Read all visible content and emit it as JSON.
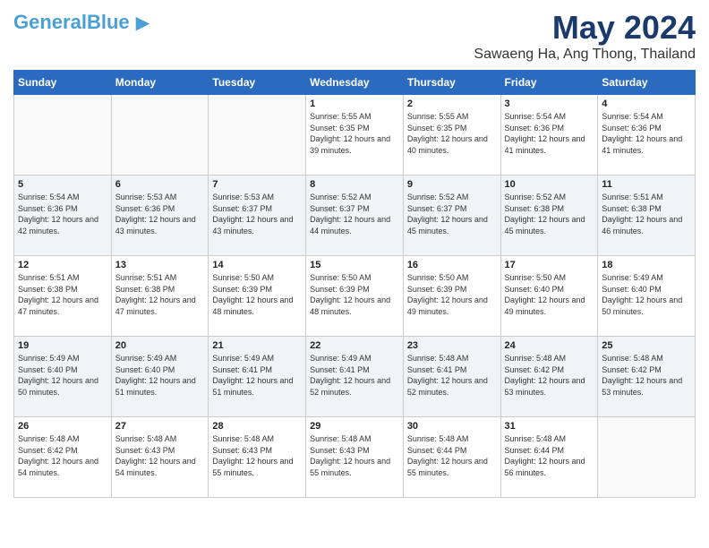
{
  "header": {
    "logo_line1": "General",
    "logo_line2": "Blue",
    "month": "May 2024",
    "location": "Sawaeng Ha, Ang Thong, Thailand"
  },
  "weekdays": [
    "Sunday",
    "Monday",
    "Tuesday",
    "Wednesday",
    "Thursday",
    "Friday",
    "Saturday"
  ],
  "weeks": [
    [
      {
        "day": "",
        "sunrise": "",
        "sunset": "",
        "daylight": ""
      },
      {
        "day": "",
        "sunrise": "",
        "sunset": "",
        "daylight": ""
      },
      {
        "day": "",
        "sunrise": "",
        "sunset": "",
        "daylight": ""
      },
      {
        "day": "1",
        "sunrise": "5:55 AM",
        "sunset": "6:35 PM",
        "daylight": "12 hours and 39 minutes."
      },
      {
        "day": "2",
        "sunrise": "5:55 AM",
        "sunset": "6:35 PM",
        "daylight": "12 hours and 40 minutes."
      },
      {
        "day": "3",
        "sunrise": "5:54 AM",
        "sunset": "6:36 PM",
        "daylight": "12 hours and 41 minutes."
      },
      {
        "day": "4",
        "sunrise": "5:54 AM",
        "sunset": "6:36 PM",
        "daylight": "12 hours and 41 minutes."
      }
    ],
    [
      {
        "day": "5",
        "sunrise": "5:54 AM",
        "sunset": "6:36 PM",
        "daylight": "12 hours and 42 minutes."
      },
      {
        "day": "6",
        "sunrise": "5:53 AM",
        "sunset": "6:36 PM",
        "daylight": "12 hours and 43 minutes."
      },
      {
        "day": "7",
        "sunrise": "5:53 AM",
        "sunset": "6:37 PM",
        "daylight": "12 hours and 43 minutes."
      },
      {
        "day": "8",
        "sunrise": "5:52 AM",
        "sunset": "6:37 PM",
        "daylight": "12 hours and 44 minutes."
      },
      {
        "day": "9",
        "sunrise": "5:52 AM",
        "sunset": "6:37 PM",
        "daylight": "12 hours and 45 minutes."
      },
      {
        "day": "10",
        "sunrise": "5:52 AM",
        "sunset": "6:38 PM",
        "daylight": "12 hours and 45 minutes."
      },
      {
        "day": "11",
        "sunrise": "5:51 AM",
        "sunset": "6:38 PM",
        "daylight": "12 hours and 46 minutes."
      }
    ],
    [
      {
        "day": "12",
        "sunrise": "5:51 AM",
        "sunset": "6:38 PM",
        "daylight": "12 hours and 47 minutes."
      },
      {
        "day": "13",
        "sunrise": "5:51 AM",
        "sunset": "6:38 PM",
        "daylight": "12 hours and 47 minutes."
      },
      {
        "day": "14",
        "sunrise": "5:50 AM",
        "sunset": "6:39 PM",
        "daylight": "12 hours and 48 minutes."
      },
      {
        "day": "15",
        "sunrise": "5:50 AM",
        "sunset": "6:39 PM",
        "daylight": "12 hours and 48 minutes."
      },
      {
        "day": "16",
        "sunrise": "5:50 AM",
        "sunset": "6:39 PM",
        "daylight": "12 hours and 49 minutes."
      },
      {
        "day": "17",
        "sunrise": "5:50 AM",
        "sunset": "6:40 PM",
        "daylight": "12 hours and 49 minutes."
      },
      {
        "day": "18",
        "sunrise": "5:49 AM",
        "sunset": "6:40 PM",
        "daylight": "12 hours and 50 minutes."
      }
    ],
    [
      {
        "day": "19",
        "sunrise": "5:49 AM",
        "sunset": "6:40 PM",
        "daylight": "12 hours and 50 minutes."
      },
      {
        "day": "20",
        "sunrise": "5:49 AM",
        "sunset": "6:40 PM",
        "daylight": "12 hours and 51 minutes."
      },
      {
        "day": "21",
        "sunrise": "5:49 AM",
        "sunset": "6:41 PM",
        "daylight": "12 hours and 51 minutes."
      },
      {
        "day": "22",
        "sunrise": "5:49 AM",
        "sunset": "6:41 PM",
        "daylight": "12 hours and 52 minutes."
      },
      {
        "day": "23",
        "sunrise": "5:48 AM",
        "sunset": "6:41 PM",
        "daylight": "12 hours and 52 minutes."
      },
      {
        "day": "24",
        "sunrise": "5:48 AM",
        "sunset": "6:42 PM",
        "daylight": "12 hours and 53 minutes."
      },
      {
        "day": "25",
        "sunrise": "5:48 AM",
        "sunset": "6:42 PM",
        "daylight": "12 hours and 53 minutes."
      }
    ],
    [
      {
        "day": "26",
        "sunrise": "5:48 AM",
        "sunset": "6:42 PM",
        "daylight": "12 hours and 54 minutes."
      },
      {
        "day": "27",
        "sunrise": "5:48 AM",
        "sunset": "6:43 PM",
        "daylight": "12 hours and 54 minutes."
      },
      {
        "day": "28",
        "sunrise": "5:48 AM",
        "sunset": "6:43 PM",
        "daylight": "12 hours and 55 minutes."
      },
      {
        "day": "29",
        "sunrise": "5:48 AM",
        "sunset": "6:43 PM",
        "daylight": "12 hours and 55 minutes."
      },
      {
        "day": "30",
        "sunrise": "5:48 AM",
        "sunset": "6:44 PM",
        "daylight": "12 hours and 55 minutes."
      },
      {
        "day": "31",
        "sunrise": "5:48 AM",
        "sunset": "6:44 PM",
        "daylight": "12 hours and 56 minutes."
      },
      {
        "day": "",
        "sunrise": "",
        "sunset": "",
        "daylight": ""
      }
    ]
  ],
  "labels": {
    "sunrise_prefix": "Sunrise: ",
    "sunset_prefix": "Sunset: ",
    "daylight_prefix": "Daylight: "
  }
}
